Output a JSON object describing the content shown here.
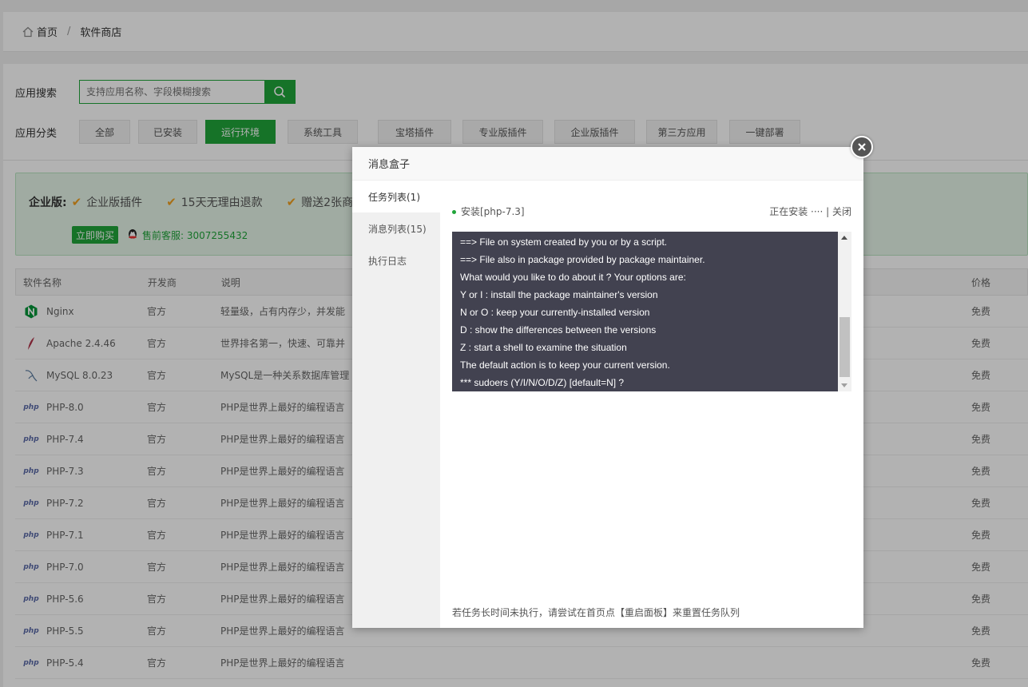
{
  "breadcrumb": {
    "home": "首页",
    "separator": "/",
    "current": "软件商店"
  },
  "search": {
    "label": "应用搜索",
    "placeholder": "支持应用名称、字段模糊搜索"
  },
  "categories": {
    "label": "应用分类",
    "items": [
      {
        "label": "全部",
        "active": false
      },
      {
        "label": "已安装",
        "active": false
      },
      {
        "label": "运行环境",
        "active": true
      },
      {
        "label": "系统工具",
        "active": false
      },
      {
        "label": "宝塔插件",
        "active": false
      },
      {
        "label": "专业版插件",
        "active": false
      },
      {
        "label": "企业版插件",
        "active": false
      },
      {
        "label": "第三方应用",
        "active": false
      },
      {
        "label": "一键部署",
        "active": false
      }
    ]
  },
  "enterprise": {
    "label": "企业版:",
    "features": [
      "企业版插件",
      "15天无理由退款",
      "赠送2张商"
    ],
    "buy_label": "立即购买",
    "service": "售前客服: 3007255432"
  },
  "table": {
    "headers": {
      "name": "软件名称",
      "dev": "开发商",
      "desc": "说明",
      "price": "价格"
    },
    "rows": [
      {
        "name": "Nginx",
        "icon": "nginx-icon",
        "dev": "官方",
        "desc": "轻量级，占有内存少，并发能",
        "price": "免费"
      },
      {
        "name": "Apache 2.4.46",
        "icon": "apache-feather-icon",
        "dev": "官方",
        "desc": "世界排名第一，快速、可靠并",
        "price": "免费"
      },
      {
        "name": "MySQL 8.0.23",
        "icon": "mysql-dolphin-icon",
        "dev": "官方",
        "desc": "MySQL是一种关系数据库管理",
        "price": "免费"
      },
      {
        "name": "PHP-8.0",
        "icon": "php-icon",
        "dev": "官方",
        "desc": "PHP是世界上最好的编程语言",
        "price": "免费"
      },
      {
        "name": "PHP-7.4",
        "icon": "php-icon",
        "dev": "官方",
        "desc": "PHP是世界上最好的编程语言",
        "price": "免费"
      },
      {
        "name": "PHP-7.3",
        "icon": "php-icon",
        "dev": "官方",
        "desc": "PHP是世界上最好的编程语言",
        "price": "免费"
      },
      {
        "name": "PHP-7.2",
        "icon": "php-icon",
        "dev": "官方",
        "desc": "PHP是世界上最好的编程语言",
        "price": "免费"
      },
      {
        "name": "PHP-7.1",
        "icon": "php-icon",
        "dev": "官方",
        "desc": "PHP是世界上最好的编程语言",
        "price": "免费"
      },
      {
        "name": "PHP-7.0",
        "icon": "php-icon",
        "dev": "官方",
        "desc": "PHP是世界上最好的编程语言",
        "price": "免费"
      },
      {
        "name": "PHP-5.6",
        "icon": "php-icon",
        "dev": "官方",
        "desc": "PHP是世界上最好的编程语言",
        "price": "免费"
      },
      {
        "name": "PHP-5.5",
        "icon": "php-icon",
        "dev": "官方",
        "desc": "PHP是世界上最好的编程语言",
        "price": "免费"
      },
      {
        "name": "PHP-5.4",
        "icon": "php-icon",
        "dev": "官方",
        "desc": "PHP是世界上最好的编程语言",
        "price": "免费"
      }
    ]
  },
  "modal": {
    "title": "消息盒子",
    "tabs": [
      {
        "label": "任务列表(1)",
        "active": true
      },
      {
        "label": "消息列表(15)",
        "active": false
      },
      {
        "label": "执行日志",
        "active": false
      }
    ],
    "task": {
      "title": "安装[php-7.3]",
      "status": "正在安装 ····",
      "separator": "|",
      "close_label": "关闭"
    },
    "console_lines": [
      "==> File on system created by you or by a script.",
      "==> File also in package provided by package maintainer.",
      "What would you like to do about it ?  Your options are:",
      "Y or I  : install the package maintainer's version",
      "N or O  : keep your currently-installed version",
      "D     : show the differences between the versions",
      "Z     : start a shell to examine the situation",
      "The default action is to keep your current version.",
      "*** sudoers (Y/I/N/O/D/Z) [default=N] ?"
    ],
    "footer_note": "若任务长时间未执行，请尝试在首页点【重启面板】来重置任务队列"
  },
  "colors": {
    "accent": "#20a53a",
    "console_bg": "#424250"
  }
}
